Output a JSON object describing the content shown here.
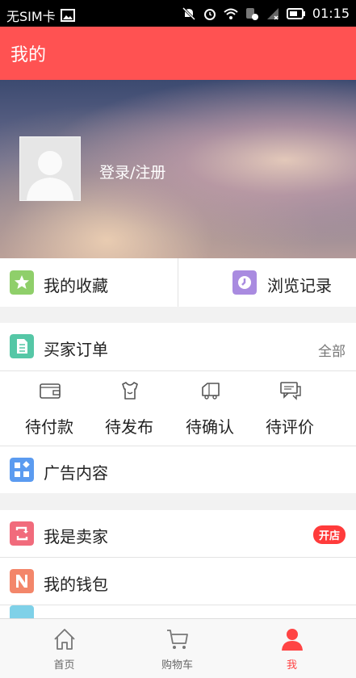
{
  "status_bar": {
    "carrier": "无SIM卡",
    "time": "01:15"
  },
  "header": {
    "title": "我的"
  },
  "profile": {
    "login_label": "登录/注册"
  },
  "quick": [
    {
      "label": "我的收藏",
      "icon": "star-icon",
      "color": "#8fcf6a"
    },
    {
      "label": "浏览记录",
      "icon": "history-icon",
      "color": "#a98be0"
    }
  ],
  "orders": {
    "title": "买家订单",
    "all_label": "全部",
    "icon": "document-icon",
    "color": "#55c7a6",
    "statuses": [
      {
        "label": "待付款",
        "icon": "wallet-icon"
      },
      {
        "label": "待发布",
        "icon": "shirt-icon"
      },
      {
        "label": "待确认",
        "icon": "truck-icon"
      },
      {
        "label": "待评价",
        "icon": "comment-icon"
      }
    ]
  },
  "ads": {
    "label": "广告内容",
    "icon": "grid-icon",
    "color": "#5b9bf0"
  },
  "seller": {
    "label": "我是卖家",
    "badge": "开店",
    "icon": "repeat-icon",
    "color": "#f16b7c"
  },
  "wallet": {
    "label": "我的钱包",
    "icon": "n-icon",
    "color": "#f3866a"
  },
  "tabs": [
    {
      "label": "首页",
      "icon": "home-icon"
    },
    {
      "label": "购物车",
      "icon": "cart-icon"
    },
    {
      "label": "我",
      "icon": "person-icon",
      "active": true
    }
  ],
  "colors": {
    "accent": "#ff5252",
    "active_tab": "#ff4444"
  }
}
